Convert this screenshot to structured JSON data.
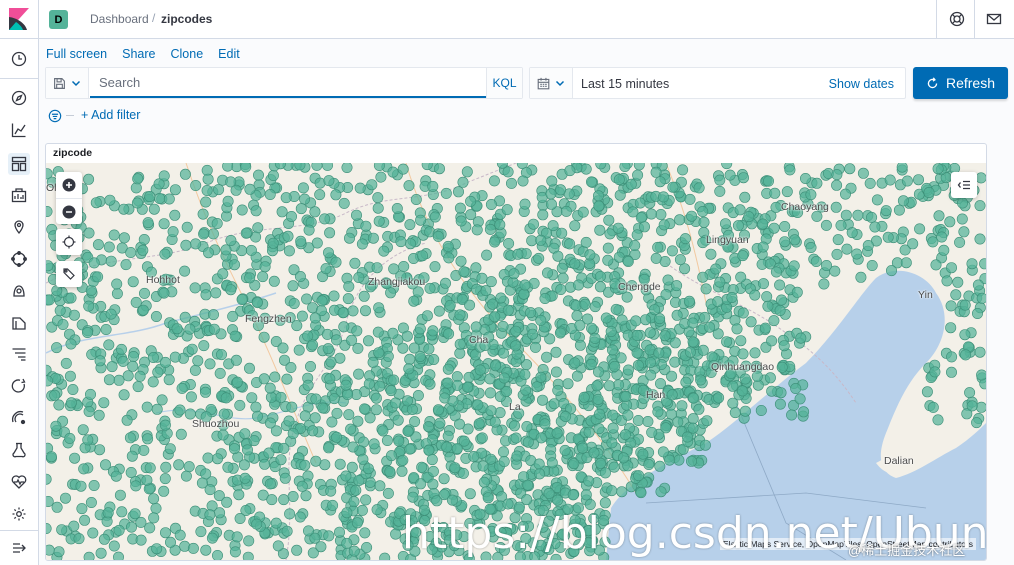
{
  "colors": {
    "accent": "#006bb4",
    "dot_fill": "#54b399",
    "water": "#b7d0ea",
    "land": "#f3f0e8"
  },
  "header": {
    "space_badge": "D",
    "breadcrumbs": [
      "Dashboard",
      "zipcodes"
    ]
  },
  "nav": {
    "icons": [
      "clock-icon",
      "compass-icon",
      "bar-chart-icon",
      "dashboard-icon",
      "canvas-icon",
      "maps-icon",
      "ml-icon",
      "metrics-icon",
      "logs-icon",
      "apm-icon",
      "uptime-icon",
      "siem-icon",
      "dev-tools-icon",
      "monitoring-icon",
      "gear-icon",
      "collapse-icon"
    ]
  },
  "top_menu": [
    "Full screen",
    "Share",
    "Clone",
    "Edit"
  ],
  "search": {
    "placeholder": "Search",
    "language": "KQL"
  },
  "time": {
    "label": "Last 15 minutes",
    "show_dates": "Show dates"
  },
  "refresh_label": "Refresh",
  "filter": {
    "add_label": "+ Add filter"
  },
  "panel": {
    "title": "zipcode",
    "cities": [
      "Ol",
      "Chaoyang",
      "Lingyuan",
      "Hohhot",
      "Zhangjiakou",
      "Chengde",
      "Fengzhen",
      "Chengde",
      "Yingkou",
      "Qinhuangdao",
      "Shuozhou",
      "Dalian"
    ],
    "city_labels": {
      "ol": "Ol",
      "chaoyang": "Chaoyang",
      "lingyuan": "Lingyuan",
      "hohhot": "Hohhot",
      "zhangjiakou": "Zhangjiakou",
      "chengde": "Chengde",
      "fengzhen": "Fengzhen",
      "yingkou": "Yin",
      "qinhuangdao": "Qinhuangdao",
      "shuozhou": "Shuozhou",
      "dalian": "Dalian",
      "la": "La",
      "cha": "Cha",
      "han": "Han"
    },
    "attribution": "Elastic Maps Service, OpenMapTiles, OpenStreetMap contributors"
  },
  "watermark": {
    "url": "https://blog.csdn.net/UbuntuTouc",
    "juejin": "@稀土掘金技术社区"
  }
}
